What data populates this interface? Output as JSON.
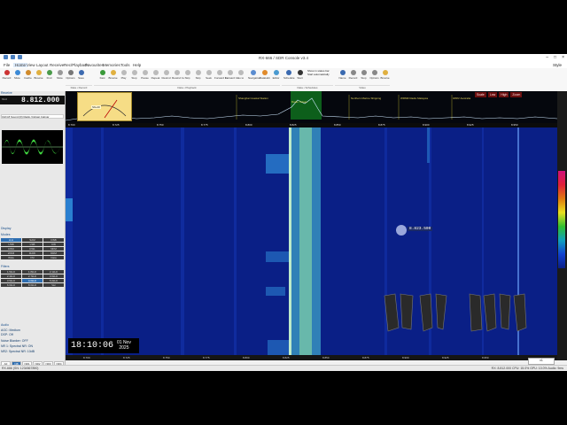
{
  "window": {
    "title": "RX-666 / SDR Console v3.4"
  },
  "menu": [
    "File",
    "Home",
    "View",
    "Layout",
    "Receive",
    "Rec/Playback",
    "Favourites",
    "Memories",
    "Tools",
    "Help"
  ],
  "menu_style": "Style",
  "ribbon": {
    "buttons": [
      "Record",
      "Mute",
      "Cache",
      "Browse",
      "Find",
      "Mute",
      "Options",
      "Save",
      "Play",
      "Fast",
      "Browse",
      "Play",
      "Stop",
      "Pause",
      "Repeat",
      "Rewind",
      "Rewind 1s",
      "Skip",
      "Skip",
      "Seek",
      "Forward 1s",
      "Forward 1s",
      "Go to",
      "Navigation",
      "DataHub",
      "Editor",
      "Show",
      "Schedule",
      "Start"
    ],
    "groups": [
      "Data • Record",
      "Data • Playback",
      "Data • Schedules",
      "Video"
    ],
    "schedule_note": "Show in status bar\nStart automatically",
    "video_buttons": [
      "Name",
      "Record",
      "Stop",
      "Options",
      "Browse"
    ]
  },
  "left": {
    "receive_label": "Receive",
    "frequency": "8.812.000",
    "station": "CHN-8 Sound (R) Radio Vidcast Calmar",
    "sections": {
      "display": "Display",
      "modes": "Modes",
      "filters": "Filters",
      "audio": "Audio"
    },
    "modes": [
      "A.A",
      "SAM",
      "DSB",
      "USB",
      "LSB",
      "CW",
      "CWU",
      "CWL",
      "NFM",
      "WFM",
      "RAW",
      "DRM",
      "Wide",
      "FM",
      "Data"
    ],
    "filters": [
      "1.5kHz",
      "1.8kHz",
      "2.1kHz",
      "2.4kHz",
      "2.7kHz",
      "3.0kHz",
      "3.5kHz",
      "4.0kHz",
      "5.0kHz",
      "6.0kHz",
      "8.0kHz",
      "Var"
    ],
    "settings": [
      "AGC: Medium",
      "DSP: Off",
      "Noise Blanker: OFF",
      "NR 1: Spectral NR: ON",
      "NR2: Spectral NR: 10dB"
    ],
    "bands": [
      "AF",
      "NB",
      "NR1",
      "NR2",
      "NR3",
      "NR4"
    ],
    "volume": "Volume",
    "squelch": "Squelch: OFF",
    "speaker": "Speaker: Off",
    "mode_selected": 0,
    "filter_selected": 7,
    "band_selected": 1
  },
  "spectrum": {
    "readout": [
      "Scale",
      "Low",
      "High",
      "Zoom"
    ],
    "labels": [
      "Shanghai Coastal Station",
      "Radio Taiwan",
      "Northern Marine Shipping",
      "WRMR Radio Malaysia",
      "IWRV Australia"
    ],
    "axis": [
      "8.700",
      "8.725",
      "8.750",
      "8.775",
      "8.800",
      "8.825",
      "8.850",
      "8.875",
      "8.900",
      "8.925",
      "8.950"
    ],
    "meter_value": "S9+40"
  },
  "waterfall": {
    "cursor_freq": "8.823.500",
    "time": "18:10:06",
    "date_line1": "01 Nov",
    "date_line2": "2025",
    "bottom_axis": [
      "8.700",
      "8.725",
      "8.750",
      "8.775",
      "8.800",
      "8.825",
      "8.850",
      "8.875",
      "8.900",
      "8.925",
      "8.950"
    ],
    "zoom": "x1"
  },
  "status": {
    "left": "RX-666 (SN: 1234567890)",
    "right": "RX: 8.812.000   CPU: 15.0%   GPU: 10.0%   Audio: 9ms"
  },
  "colors": {
    "waterfall_bg": "#0a1f86",
    "accent": "#2d6db0",
    "meter": "#f6dd86"
  },
  "icons": [
    "record-icon",
    "play-icon",
    "stop-icon",
    "schedule-icon",
    "gear-icon"
  ]
}
